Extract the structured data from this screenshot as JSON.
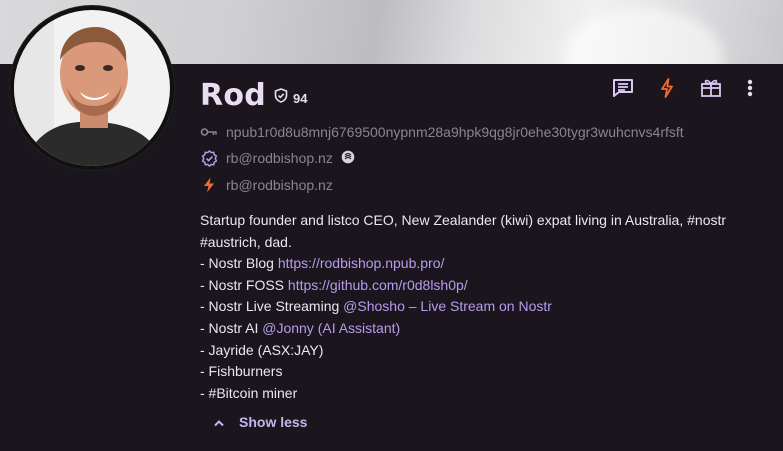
{
  "profile": {
    "name": "Rod",
    "trust_score": "94",
    "npub": "npub1r0d8u8mnj6769500nypnm28a9hpk9qg8jr0ehe30tygr3wuhcnvs4rfsft",
    "nip05": "rb@rodbishop.nz",
    "lightning": "rb@rodbishop.nz"
  },
  "actions": {
    "message_icon": "message-icon",
    "zap_icon": "zap-icon",
    "gift_icon": "gift-icon",
    "more_icon": "more-icon"
  },
  "bio": {
    "line1": "Startup founder and listco CEO, New Zealander (kiwi) expat living in Australia, #nostr #austrich, dad.",
    "blog_prefix": "- Nostr Blog ",
    "blog_link": "https://rodbishop.npub.pro/",
    "foss_prefix": "- Nostr FOSS ",
    "foss_link": "https://github.com/r0d8lsh0p/",
    "live_prefix": "- Nostr Live Streaming ",
    "live_link": "@Shosho – Live Stream on Nostr",
    "ai_prefix": "- Nostr AI ",
    "ai_link": "@Jonny (AI Assistant)",
    "item_jayride": "- Jayride (ASX:JAY)",
    "item_fishburners": "- Fishburners",
    "item_bitcoin": "- #Bitcoin miner"
  },
  "toggle": {
    "label": "Show less"
  },
  "colors": {
    "background": "#1b161d",
    "name": "#eadcf3",
    "link": "#b79bee",
    "zap": "#f36c2d",
    "accent": "#c6b4ef"
  }
}
